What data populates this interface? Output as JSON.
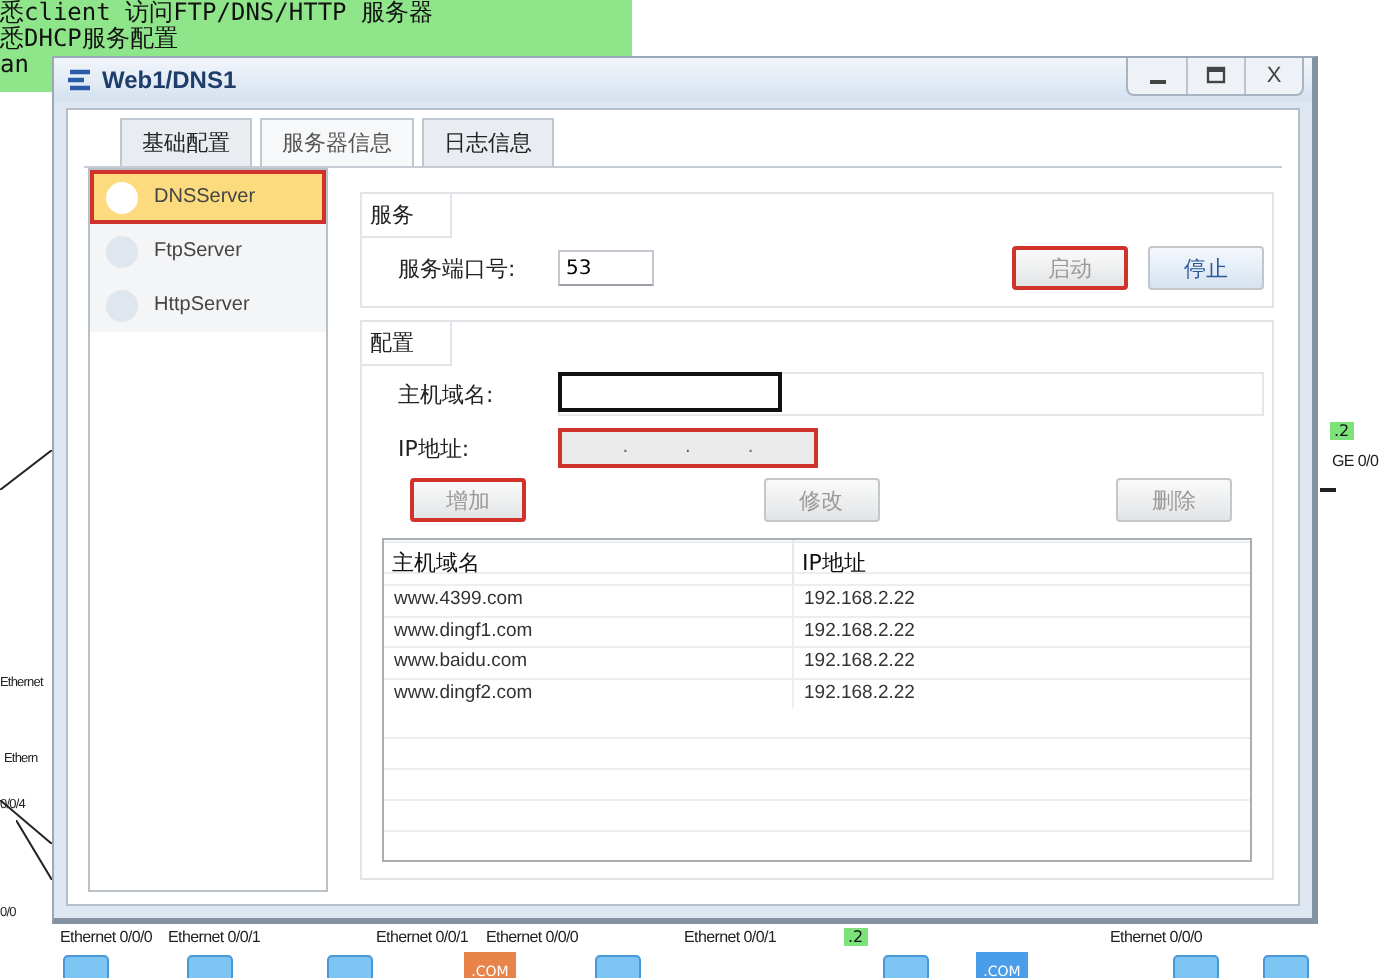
{
  "background": {
    "note_lines": [
      "悉client 访问FTP/DNS/HTTP 服务器",
      "悉DHCP服务配置",
      "an"
    ],
    "port_labels": [
      "Ethernet",
      "Ethern",
      "0/0/4",
      "0/0",
      "Ethernet 0/0/0",
      "Ethernet 0/0/1",
      "Ethernet 0/0/1",
      "Ethernet 0/0/0",
      "Ethernet 0/0/1",
      "Ethernet 0/0/0",
      "GE 0/0"
    ],
    "link_tags": [
      ".2",
      ".2"
    ],
    "server_labels": [
      ".COM",
      ".COM"
    ]
  },
  "window": {
    "title": "Web1/DNS1",
    "close_label": "X"
  },
  "tabs": [
    {
      "label": "基础配置",
      "selected": false
    },
    {
      "label": "服务器信息",
      "selected": true
    },
    {
      "label": "日志信息",
      "selected": false
    }
  ],
  "sidebar": {
    "items": [
      {
        "label": "DNSServer",
        "selected": true,
        "annotated": true
      },
      {
        "label": "FtpServer",
        "selected": false,
        "annotated": false
      },
      {
        "label": "HttpServer",
        "selected": false,
        "annotated": false
      }
    ]
  },
  "service": {
    "title": "服务",
    "port_label": "服务端口号:",
    "port_value": "53",
    "buttons": [
      {
        "label": "启动",
        "disabled": true,
        "annotated": true
      },
      {
        "label": "停止",
        "disabled": false,
        "annotated": false
      }
    ]
  },
  "config": {
    "title": "配置",
    "host_label": "主机域名:",
    "host_focused": true,
    "ip_label": "IP地址:",
    "ip_separators": [
      ".",
      ".",
      "."
    ],
    "ip_annotated": true,
    "buttons": [
      {
        "label": "增加",
        "disabled": true,
        "annotated": true
      },
      {
        "label": "修改",
        "disabled": true,
        "annotated": false
      },
      {
        "label": "删除",
        "disabled": true,
        "annotated": false
      }
    ]
  },
  "table": {
    "columns": [
      "主机域名",
      "IP地址"
    ],
    "rows": [
      [
        "www.4399.com",
        "192.168.2.22"
      ],
      [
        "www.dingf1.com",
        "192.168.2.22"
      ],
      [
        "www.baidu.com",
        "192.168.2.22"
      ],
      [
        "www.dingf2.com",
        "192.168.2.22"
      ]
    ]
  }
}
